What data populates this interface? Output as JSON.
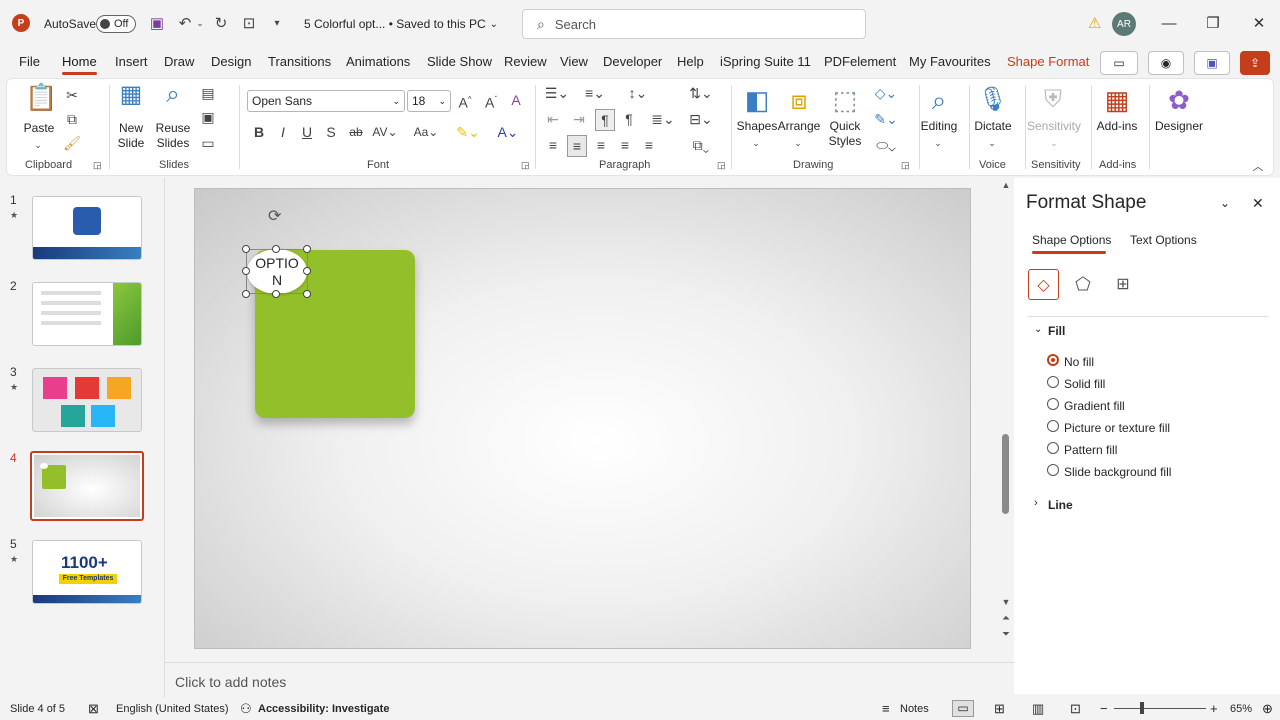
{
  "titlebar": {
    "logo": "P",
    "autosave_label": "AutoSave",
    "autosave_state": "Off",
    "doc_title": "5 Colorful opt... • Saved to this PC",
    "search_placeholder": "Search",
    "avatar": "AR"
  },
  "menu": [
    "File",
    "Home",
    "Insert",
    "Draw",
    "Design",
    "Transitions",
    "Animations",
    "Slide Show",
    "Review",
    "View",
    "Developer",
    "Help",
    "iSpring Suite 11",
    "PDFelement",
    "My Favourites",
    "Shape Format"
  ],
  "ribbon": {
    "clipboard": {
      "paste": "Paste",
      "label": "Clipboard"
    },
    "slides": {
      "new_slide": "New Slide",
      "reuse": "Reuse Slides",
      "label": "Slides"
    },
    "font": {
      "family": "Open Sans",
      "size": "18",
      "label": "Font"
    },
    "paragraph": {
      "label": "Paragraph"
    },
    "drawing": {
      "shapes": "Shapes",
      "arrange": "Arrange",
      "quick": "Quick Styles",
      "label": "Drawing"
    },
    "editing": {
      "label": "Editing"
    },
    "voice": {
      "dictate": "Dictate",
      "label": "Voice"
    },
    "sensitivity": {
      "btn": "Sensitivity",
      "label": "Sensitivity"
    },
    "addins": {
      "btn": "Add-ins",
      "label": "Add-ins"
    },
    "designer": {
      "btn": "Designer"
    }
  },
  "thumbnails": [
    {
      "num": "1",
      "star": "★"
    },
    {
      "num": "2",
      "star": ""
    },
    {
      "num": "3",
      "star": "★"
    },
    {
      "num": "4",
      "star": ""
    },
    {
      "num": "5",
      "star": "★"
    }
  ],
  "thumb5_text": {
    "big": "1100+",
    "sub": "Free Templates"
  },
  "slide": {
    "circle_text_1": "OPTIO",
    "circle_text_2": "N"
  },
  "notes_placeholder": "Click to add notes",
  "format_pane": {
    "title": "Format Shape",
    "tab_shape": "Shape Options",
    "tab_text": "Text Options",
    "fill_section": "Fill",
    "fill_options": [
      "No fill",
      "Solid fill",
      "Gradient fill",
      "Picture or texture fill",
      "Pattern fill",
      "Slide background fill"
    ],
    "line_section": "Line"
  },
  "status": {
    "slide_info": "Slide 4 of 5",
    "language": "English (United States)",
    "accessibility": "Accessibility: Investigate",
    "notes": "Notes",
    "zoom": "65%"
  },
  "colors": {
    "accent": "#c43e1c",
    "green": "#93c02a"
  }
}
